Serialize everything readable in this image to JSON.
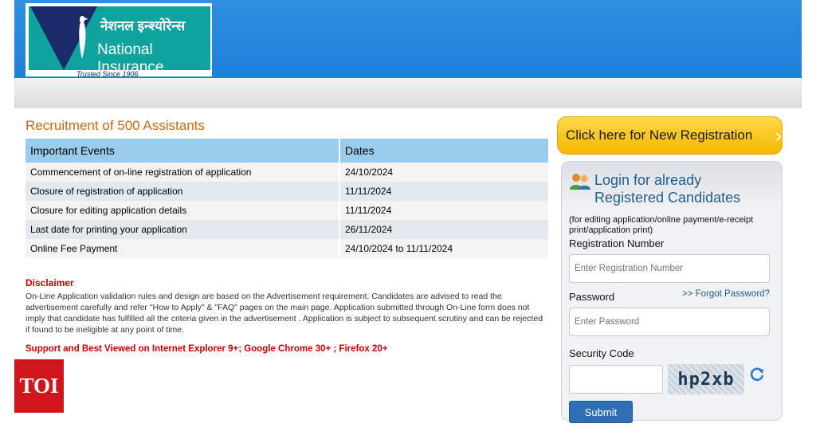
{
  "header": {
    "logo_hindi": "नेशनल इन्श्योरेन्स",
    "logo_english": "National Insurance",
    "logo_tagline": "Trusted Since 1906"
  },
  "main": {
    "title": "Recruitment of 500 Assistants",
    "table": {
      "headers": [
        "Important Events",
        "Dates"
      ],
      "rows": [
        [
          "Commencement of on-line registration of application",
          "24/10/2024"
        ],
        [
          "Closure of registration of application",
          "11/11/2024"
        ],
        [
          "Closure for editing application details",
          "11/11/2024"
        ],
        [
          "Last date for printing your application",
          "26/11/2024"
        ],
        [
          "Online Fee Payment",
          "24/10/2024 to 11/11/2024"
        ]
      ]
    },
    "disclaimer_title": "Disclaimer",
    "disclaimer_body": "On-Line Application validation rules and design are based on the Advertisement requirement. Candidates are advised to read the advertisement carefully and refer \"How to Apply\" & \"FAQ\" pages on the main page. Application submitted through On-Line form does not imply that candidate has fulfilled all the criteria given in the advertisement . Application is subject to subsequent scrutiny and can be rejected if found to be ineligible at any point of time.",
    "support_text": "Support and Best Viewed on Internet Explorer 9+; Google Chrome 30+ ; Firefox 20+"
  },
  "sidebar": {
    "new_registration_label": "Click here for New Registration",
    "login_title_line1": "Login for already",
    "login_title_line2": "Registered Candidates",
    "login_note": "(for editing application/online payment/e-receipt print/application print)",
    "registration_label": "Registration Number",
    "registration_placeholder": "Enter Registration Number",
    "password_label": "Password",
    "forgot_label": ">> Forgot Password?",
    "password_placeholder": "Enter Password",
    "security_label": "Security Code",
    "captcha_text": "hp2xb",
    "submit_label": "Submit"
  },
  "watermark": {
    "text": "TOI"
  },
  "colors": {
    "header_blue": "#1c7fd9",
    "title_orange": "#c96b10",
    "table_header": "#99cbeb",
    "disclaimer_red": "#cc0000",
    "button_yellow": "#f6b800",
    "submit_blue": "#2f6eb3",
    "toi_red": "#d0161b"
  }
}
